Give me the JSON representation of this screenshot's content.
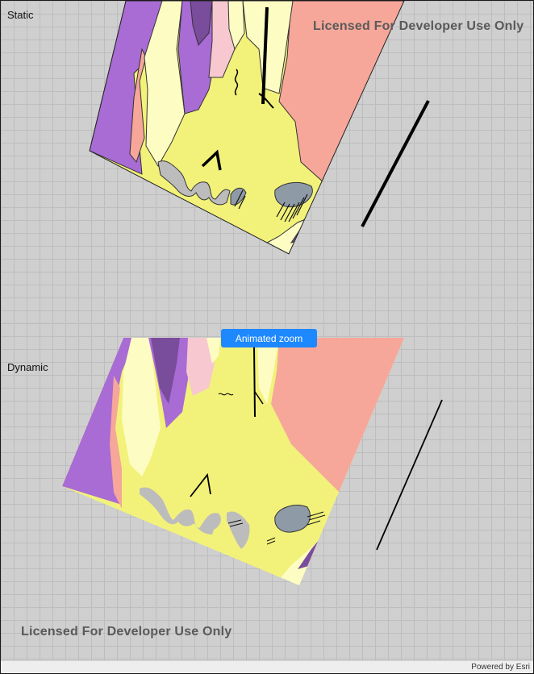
{
  "static_view": {
    "label": "Static",
    "watermark": "Licensed For Developer Use Only"
  },
  "dynamic_view": {
    "label": "Dynamic",
    "watermark": "Licensed For Developer Use Only",
    "zoom_button_label": "Animated zoom"
  },
  "attribution": "Powered by Esri",
  "colors": {
    "purple": "#a96bd4",
    "dark_purple": "#7a4c9c",
    "pale_yellow": "#fdfcc3",
    "yellow": "#f2f27a",
    "salmon": "#f6a79a",
    "pink": "#f7c8cf",
    "gray_blue": "#8e9aa6",
    "light_gray": "#bcbcbc",
    "button_blue": "#1e88ff"
  }
}
